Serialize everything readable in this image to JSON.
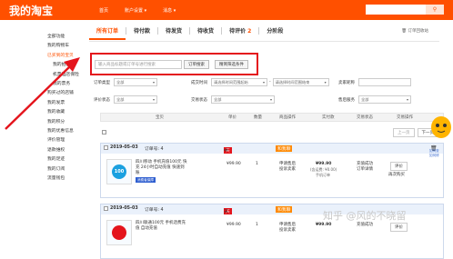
{
  "header": {
    "logo": "我的淘宝",
    "nav": [
      "首页",
      "账户设置 ▾",
      "消息 ▾"
    ]
  },
  "sidebar": {
    "items": [
      {
        "label": "全部功能",
        "active": false,
        "sub": false
      },
      {
        "label": "我的购物车",
        "active": false,
        "sub": false
      },
      {
        "label": "已买到的宝贝",
        "active": true,
        "sub": false
      },
      {
        "label": "我的拍卖",
        "active": false,
        "sub": true
      },
      {
        "label": "机票酒店保险",
        "active": false,
        "sub": true
      },
      {
        "label": "我的票务",
        "active": false,
        "sub": true
      },
      {
        "label": "购买过的店铺",
        "active": false,
        "sub": false
      },
      {
        "label": "我的发票",
        "active": false,
        "sub": false
      },
      {
        "label": "我的收藏",
        "active": false,
        "sub": false
      },
      {
        "label": "我的积分",
        "active": false,
        "sub": false
      },
      {
        "label": "我的优惠信息",
        "active": false,
        "sub": false
      },
      {
        "label": "评价管理",
        "active": false,
        "sub": false
      },
      {
        "label": "退款维权",
        "active": false,
        "sub": false
      },
      {
        "label": "我的足迹",
        "active": false,
        "sub": false
      },
      {
        "label": "我的订阅",
        "active": false,
        "sub": false
      },
      {
        "label": "流量钱包",
        "active": false,
        "sub": false
      }
    ]
  },
  "tabs": [
    {
      "label": "所有订单",
      "count": ""
    },
    {
      "label": "待付款",
      "count": ""
    },
    {
      "label": "待发货",
      "count": ""
    },
    {
      "label": "待收货",
      "count": ""
    },
    {
      "label": "待评价",
      "count": "2"
    },
    {
      "label": "分阶段",
      "count": ""
    }
  ],
  "recycle_label": "订单回收站",
  "search": {
    "placeholder": "输入商品标题或订单号进行搜索",
    "button": "订单搜索",
    "advanced": "精简筛选条件"
  },
  "filters": {
    "order_type": {
      "label": "订单类型",
      "value": "全部"
    },
    "deal_time": {
      "label": "成交时间",
      "start_placeholder": "请选择时间范围起始",
      "end_placeholder": "请选择时间范围结束"
    },
    "seller_nick": {
      "label": "卖家昵称"
    },
    "eval_status": {
      "label": "评价状态",
      "value": "全部"
    },
    "trade_status": {
      "label": "交易状态",
      "value": "全部"
    },
    "after_sale": {
      "label": "售后服务",
      "value": "全部"
    }
  },
  "table_headers": [
    "宝贝",
    "单价",
    "数量",
    "商品操作",
    "实付款",
    "交易状态",
    "交易操作"
  ],
  "pager": {
    "prev": "上一页",
    "next": "下一页"
  },
  "orders": [
    {
      "date": "2019-05-03",
      "order_id": "订单号: 4",
      "shop": "中国移动",
      "shop_badge": "和我聊",
      "product_title": "四川移动 手机充值100元 快充 24小时自动充值 快速到账",
      "product_badge": "消费者保障",
      "thumb_label": "100",
      "price": "¥99.90",
      "qty": "1",
      "ops": [
        "申请售后",
        "投诉卖家"
      ],
      "paid": "¥99.90",
      "paid_note": "(含运费: ¥0.00)",
      "paid_method": "手机订单",
      "status": [
        "充值成功",
        "订单详情"
      ],
      "actions": [
        "评价",
        "再次购买"
      ]
    },
    {
      "date": "2019-05-03",
      "order_id": "订单号: 4",
      "shop": "天猫网充旗舰店",
      "shop_badge": "和我聊",
      "product_title": "四川联通100元 手机话费充值 自动充值",
      "product_badge": "",
      "thumb_label": "",
      "price": "¥99.90",
      "qty": "1",
      "ops": [
        "申请售后",
        "投诉卖家"
      ],
      "paid": "¥99.90",
      "paid_note": "",
      "paid_method": "",
      "status": [
        "充值成功"
      ],
      "actions": [
        "评价"
      ]
    }
  ],
  "watermark": "知乎 @风的不晓留",
  "colors": {
    "brand": "#ff5000",
    "highlight": "#e4141c",
    "order_header": "#eaf1fb"
  }
}
